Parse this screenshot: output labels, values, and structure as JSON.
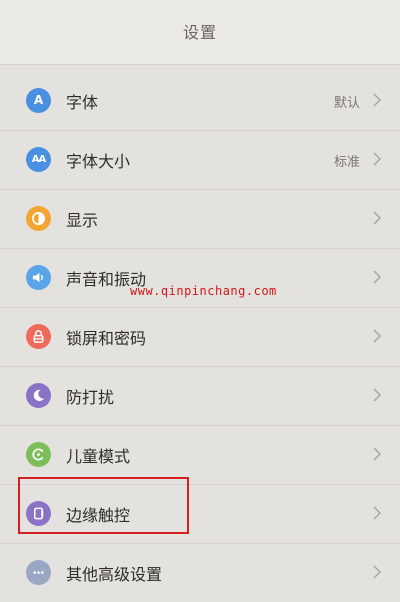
{
  "header": {
    "title": "设置"
  },
  "items": [
    {
      "label": "字体",
      "value": "默认",
      "icon": "font-icon",
      "glyph": "A",
      "color": "#4a90e2"
    },
    {
      "label": "字体大小",
      "value": "标准",
      "icon": "font-size-icon",
      "glyph": "AA",
      "color": "#4a90e2"
    },
    {
      "label": "显示",
      "value": "",
      "icon": "display-icon",
      "color": "#f2a531"
    },
    {
      "label": "声音和振动",
      "value": "",
      "icon": "sound-icon",
      "color": "#5aa4e8"
    },
    {
      "label": "锁屏和密码",
      "value": "",
      "icon": "lock-icon",
      "color": "#ef6a5a"
    },
    {
      "label": "防打扰",
      "value": "",
      "icon": "moon-icon",
      "color": "#8a72c6"
    },
    {
      "label": "儿童模式",
      "value": "",
      "icon": "child-mode-icon",
      "color": "#7cbf5a"
    },
    {
      "label": "边缘触控",
      "value": "",
      "icon": "edge-touch-icon",
      "color": "#8a72c6"
    },
    {
      "label": "其他高级设置",
      "value": "",
      "icon": "more-icon",
      "color": "#9aa7c4"
    }
  ],
  "watermark": "www.qinpinchang.com"
}
